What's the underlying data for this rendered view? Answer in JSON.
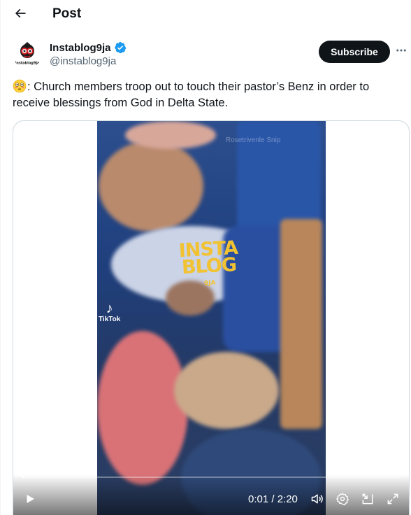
{
  "header": {
    "title": "Post",
    "back_icon": "arrow-left-icon"
  },
  "author": {
    "name": "Instablog9ja",
    "handle": "@instablog9ja",
    "verified": true,
    "avatar_logo_text": "instablog9ja",
    "verified_color": "#1d9bf0"
  },
  "actions": {
    "subscribe_label": "Subscribe",
    "more_icon": "more-horizontal-icon"
  },
  "post": {
    "emoji": "flushed-face-emoji",
    "text": ": Church members troop out to touch their pastor’s Benz in order to receive blessings from God in Delta State."
  },
  "video": {
    "watermark_main": "INSTA BLOG",
    "watermark_sub": "9JA",
    "tiktok_label": "TikTok",
    "faded_caption": "Rosetrivenle Snip",
    "progress_fraction": 0.007,
    "current_time": "0:01",
    "duration": "2:20",
    "time_display": "0:01 / 2:20",
    "controls": [
      "play-icon",
      "volume-icon",
      "settings-icon",
      "picture-in-picture-icon",
      "fullscreen-icon"
    ]
  },
  "colors": {
    "text": "#0f1419",
    "secondary": "#536471",
    "border": "#cfd9de",
    "watermark": "#f1c232"
  }
}
